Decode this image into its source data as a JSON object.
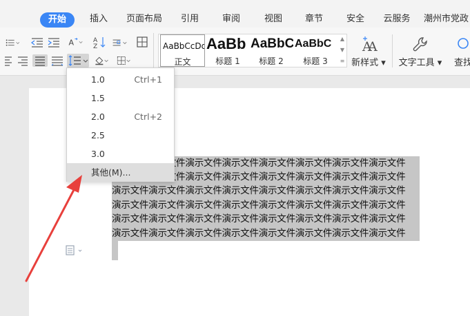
{
  "tabs": [
    "开始",
    "插入",
    "页面布局",
    "引用",
    "审阅",
    "视图",
    "章节",
    "安全",
    "云服务",
    "潮州市党政"
  ],
  "ribbon": {
    "styles": [
      {
        "preview": "AaBbCcDd",
        "name": "正文"
      },
      {
        "preview": "AaBb",
        "name": "标题 1"
      },
      {
        "preview": "AaBbC",
        "name": "标题 2"
      },
      {
        "preview": "AaBbC",
        "name": "标题 3"
      }
    ],
    "new_style_label": "新样式",
    "text_tools_label": "文字工具",
    "find_label": "查找"
  },
  "line_spacing_menu": {
    "items": [
      {
        "label": "1.0",
        "shortcut": "Ctrl+1"
      },
      {
        "label": "1.5",
        "shortcut": ""
      },
      {
        "label": "2.0",
        "shortcut": "Ctrl+2"
      },
      {
        "label": "2.5",
        "shortcut": ""
      },
      {
        "label": "3.0",
        "shortcut": ""
      },
      {
        "label": "其他(M)...",
        "shortcut": ""
      }
    ],
    "highlighted_item": "其他(M)..."
  },
  "document": {
    "lines": [
      "演示文件演示文件演示文件演示文件演示文件演示文件演示文件演示文件",
      "演示文件演示文件演示文件演示文件演示文件演示文件演示文件演示文件",
      "演示文件演示文件演示文件演示文件演示文件演示文件演示文件演示文件",
      "演示文件演示文件演示文件演示文件演示文件演示文件演示文件演示文件",
      "演示文件演示文件演示文件演示文件演示文件演示文件演示文件演示文件",
      "演示文件演示文件演示文件演示文件演示文件演示文件演示文件演示文件"
    ]
  },
  "colors": {
    "accent": "#3a86f5",
    "selection": "#c6c6c6",
    "arrow": "#e8403c"
  },
  "icons": [
    "bullet-list-icon",
    "decrease-indent-icon",
    "increase-indent-icon",
    "text-direction-icon",
    "sort-icon",
    "paragraph-settings-icon",
    "table-insert-icon",
    "align-left-icon",
    "align-right-icon",
    "justify-icon",
    "distributed-align-icon",
    "line-spacing-icon",
    "fill-color-icon",
    "borders-icon",
    "new-style-icon",
    "wrench-icon",
    "find-icon",
    "paragraph-mark-icon"
  ]
}
